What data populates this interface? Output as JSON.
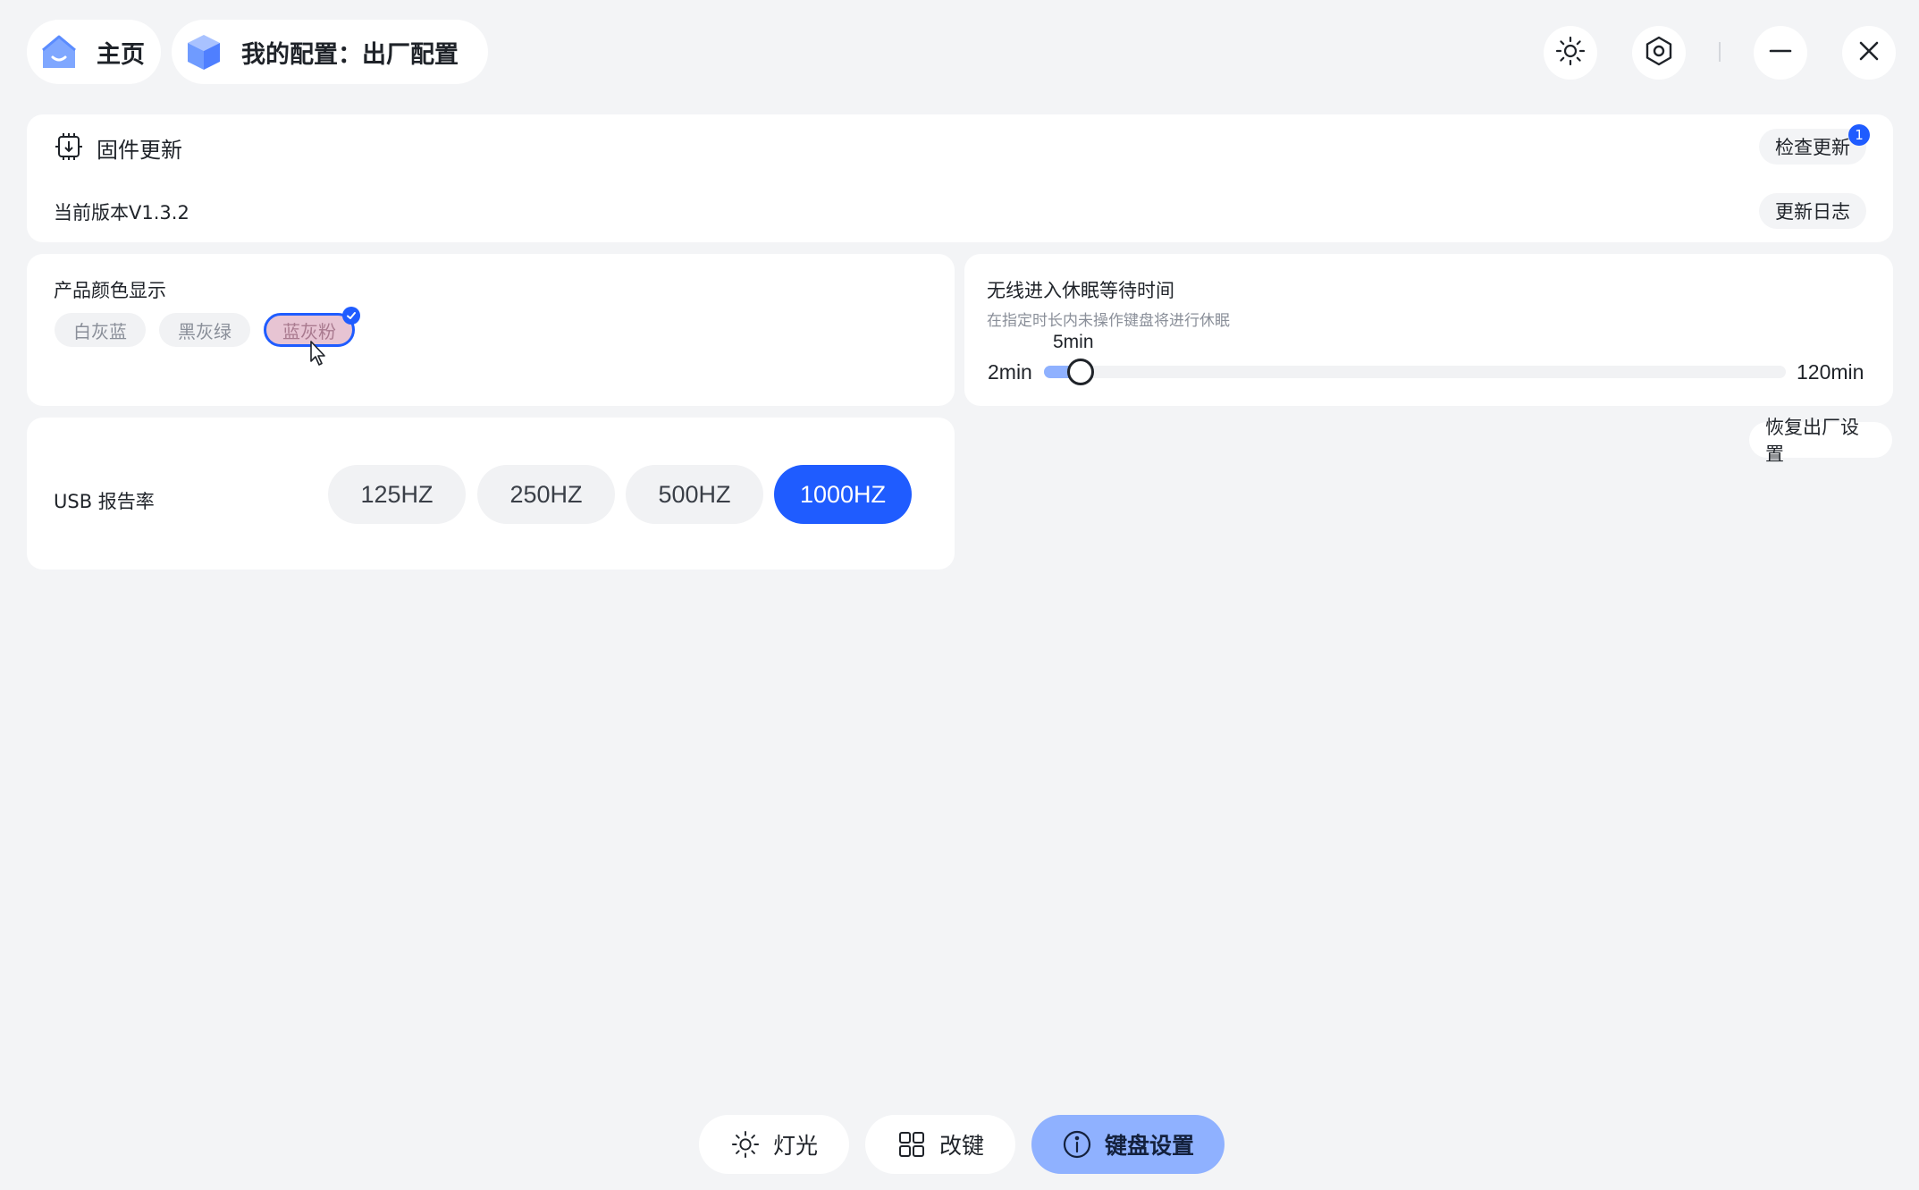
{
  "nav": {
    "home_label": "主页",
    "config_label": "我的配置：出厂配置"
  },
  "window_controls": {
    "brightness_icon": "brightness-icon",
    "settings_icon": "hexagon-settings-icon",
    "minimize_icon": "minimize-icon",
    "close_icon": "close-icon"
  },
  "firmware": {
    "title": "固件更新",
    "current_version": "当前版本V1.3.2",
    "check_update_label": "检查更新",
    "update_badge": "1",
    "changelog_label": "更新日志"
  },
  "color_display": {
    "title": "产品颜色显示",
    "options": [
      "白灰蓝",
      "黑灰绿",
      "蓝灰粉"
    ],
    "selected": "蓝灰粉"
  },
  "sleep": {
    "title": "无线进入休眠等待时间",
    "description": "在指定时长内未操作键盘将进行休眠",
    "min_label": "2min",
    "max_label": "120min",
    "current_label": "5min",
    "value": 5,
    "min": 2,
    "max": 120
  },
  "factory_reset_label": "恢复出厂设置",
  "usb": {
    "title": "USB 报告率",
    "rates": [
      "125HZ",
      "250HZ",
      "500HZ",
      "1000HZ"
    ],
    "selected": "1000HZ"
  },
  "bottom_tabs": {
    "lighting": "灯光",
    "remap": "改键",
    "keyboard_settings": "键盘设置"
  },
  "colors": {
    "accent": "#1f5cff",
    "active_tab": "#8fb1ff",
    "background": "#f3f4f6"
  }
}
